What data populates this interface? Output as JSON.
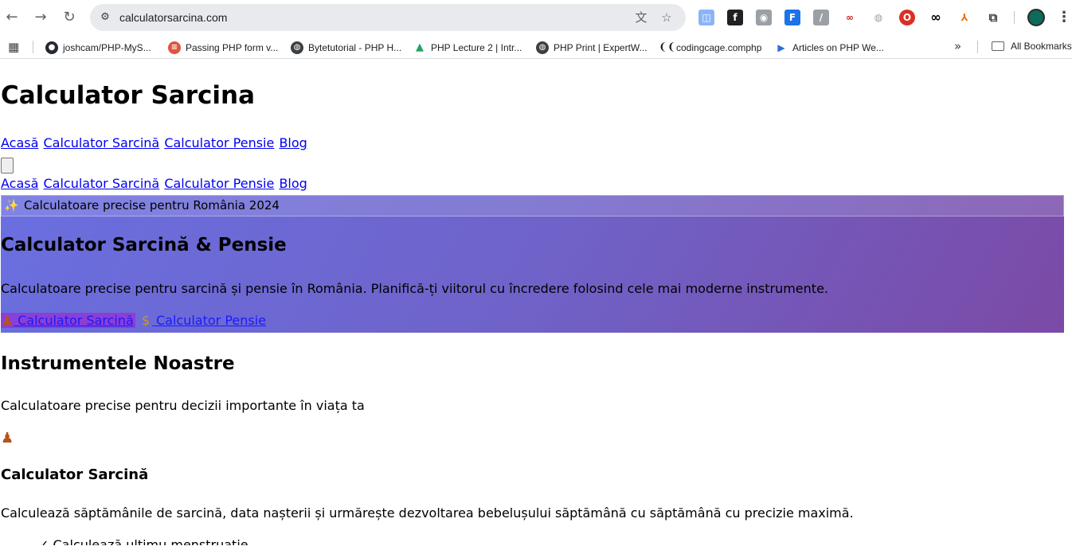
{
  "browser": {
    "url": "calculatorsarcina.com",
    "bookmarks": [
      {
        "label": "joshcam/PHP-MyS...",
        "icon": "github-icon",
        "color": "#24292f"
      },
      {
        "label": "Passing PHP form v...",
        "icon": "site-favicon",
        "color": "#e0533d"
      },
      {
        "label": "Bytetutorial - PHP H...",
        "icon": "globe-icon",
        "color": "#3c4043"
      },
      {
        "label": "PHP Lecture 2 | Intr...",
        "icon": "drive-icon",
        "color": "#1fa463"
      },
      {
        "label": "PHP Print | ExpertW...",
        "icon": "globe-icon",
        "color": "#3c4043"
      },
      {
        "label": "codingcage.comphp",
        "icon": "codingcage-icon",
        "color": "#202124"
      },
      {
        "label": "Articles on PHP We...",
        "icon": "play-icon",
        "color": "#2b6ed9"
      }
    ],
    "all_bookmarks_label": "All Bookmarks"
  },
  "page": {
    "site_title": "Calculator Sarcina",
    "nav": [
      {
        "label": "Acasă"
      },
      {
        "label": "Calculator Sarcină"
      },
      {
        "label": "Calculator Pensie"
      },
      {
        "label": "Blog"
      }
    ],
    "hero": {
      "badge": "Calculatoare precise pentru România 2024",
      "title": "Calculator Sarcină & Pensie",
      "description": "Calculatoare precise pentru sarcină și pensie în România. Planifică-ți viitorul cu încredere folosind cele mai moderne instrumente.",
      "cta_pregnancy": "Calculator Sarcină",
      "cta_pension": "Calculator Pensie"
    },
    "section": {
      "title": "Instrumentele Noastre",
      "subtitle": "Calculatoare precise pentru decizii importante în viața ta"
    },
    "card": {
      "title": "Calculator Sarcină",
      "description": "Calculează săptămânile de sarcină, data nașterii și urmărește dezvoltarea bebelușului săptămână cu săptămână cu precizie maximă.",
      "cut_line": "✓ Calculează ultimu menstruatie"
    }
  }
}
